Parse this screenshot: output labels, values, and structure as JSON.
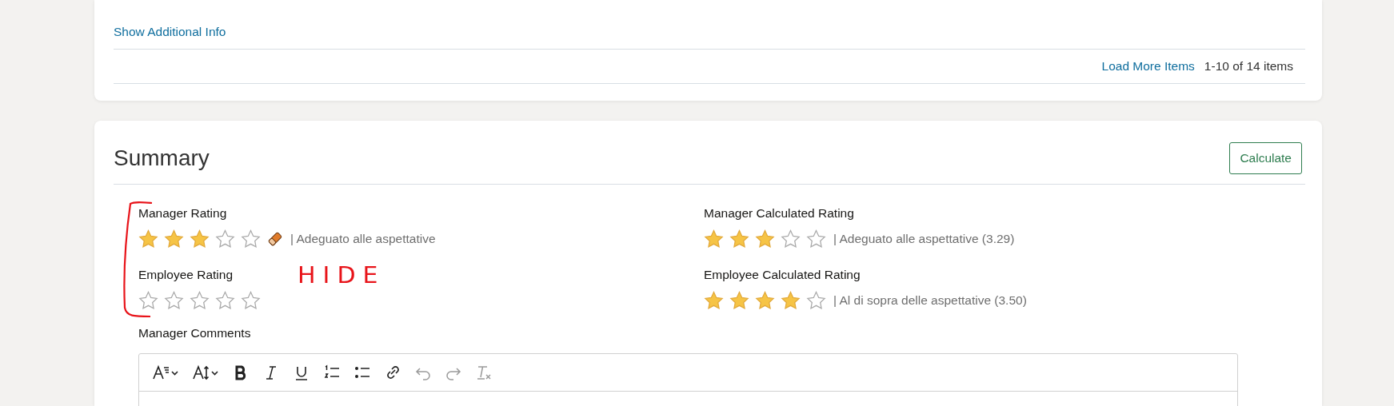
{
  "details_card": {
    "show_info_link": "Show Additional Info",
    "load_more_link": "Load More Items",
    "item_count": "1-10 of 14 items"
  },
  "summary": {
    "title": "Summary",
    "calculate_button": "Calculate",
    "ratings": [
      {
        "label": "Manager Rating",
        "stars": 3,
        "clear_icon": true,
        "value": "| Adeguato alle aspettative"
      },
      {
        "label": "Manager Calculated Rating",
        "stars": 3,
        "clear_icon": false,
        "value": "| Adeguato alle aspettative (3.29)"
      },
      {
        "label": "Employee Rating",
        "stars": 0,
        "clear_icon": false
      },
      {
        "label": "Employee Calculated Rating",
        "stars": 4,
        "clear_icon": false,
        "value": "| Al di sopra delle aspettative (3.50)"
      }
    ],
    "comments_label": "Manager Comments",
    "toolbar": [
      {
        "kind": "font-style",
        "disabled": false
      },
      {
        "kind": "font-size",
        "disabled": false
      },
      {
        "kind": "bold",
        "disabled": false
      },
      {
        "kind": "italic",
        "disabled": false
      },
      {
        "kind": "underline",
        "disabled": false
      },
      {
        "kind": "numbered-list",
        "disabled": false
      },
      {
        "kind": "bullet-list",
        "disabled": false
      },
      {
        "kind": "link",
        "disabled": false
      },
      {
        "kind": "undo",
        "disabled": true
      },
      {
        "kind": "redo",
        "disabled": true
      },
      {
        "kind": "clear-format",
        "disabled": true
      }
    ]
  },
  "annotation": {
    "text": "HIDE"
  }
}
